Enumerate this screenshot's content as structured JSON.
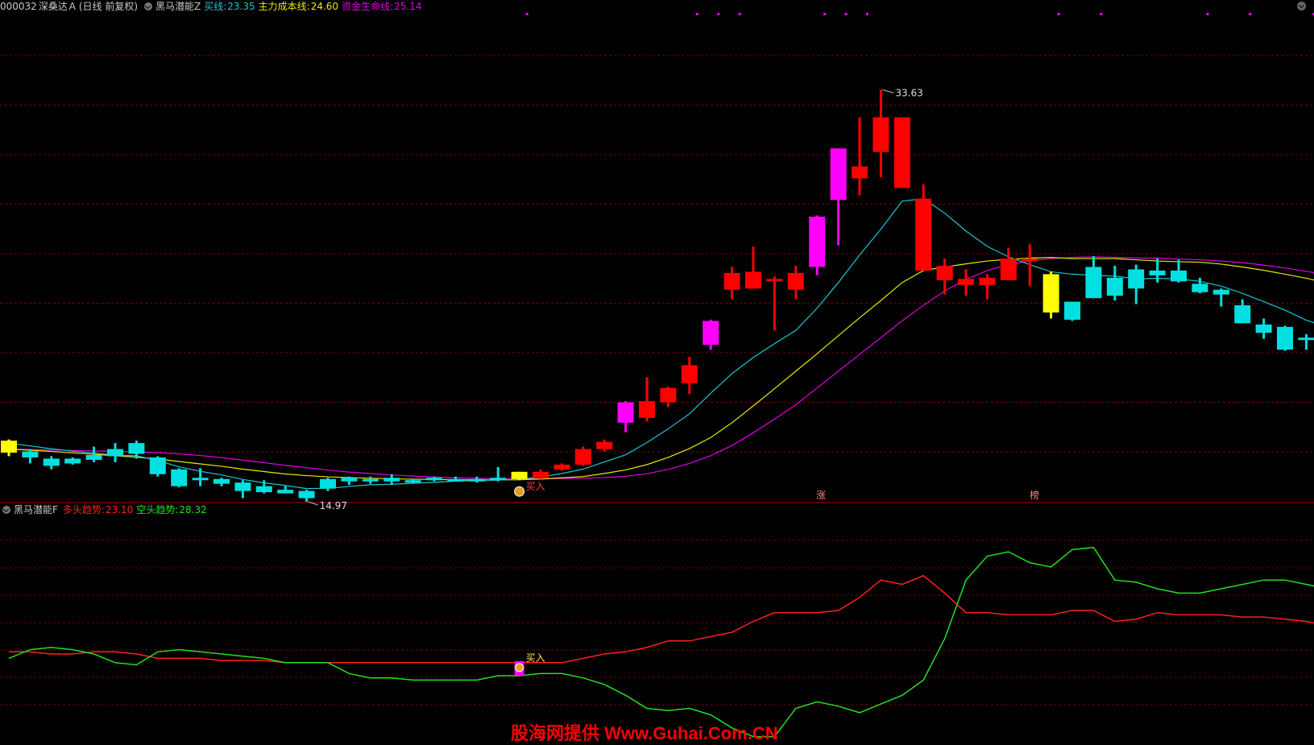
{
  "header": {
    "stock_code": "000032",
    "stock_name": "深桑达Ａ",
    "period": "(日线 前复权)",
    "indicator_name": "黑马潜能Z",
    "items": [
      {
        "label": "买线:",
        "value": "23.35",
        "color": "#19c8d2"
      },
      {
        "label": "主力成本线:",
        "value": "24.60",
        "color": "#e8e800"
      },
      {
        "label": "资金生命线:",
        "value": "25.14",
        "color": "#e000e0"
      }
    ]
  },
  "sub_header": {
    "indicator_name": "黑马潜能F",
    "items": [
      {
        "label": "多头趋势:",
        "value": "23.10",
        "color": "#ff2020"
      },
      {
        "label": "空头趋势:",
        "value": "28.32",
        "color": "#20e020"
      }
    ]
  },
  "colors": {
    "up": "#ff0000",
    "down": "#00e0e0",
    "special": "#ff00ff",
    "warn": "#ffff00",
    "grid": "#7a0000",
    "buy_line": "#19c8d2",
    "cost_line": "#e8e800",
    "life_line": "#e000e0"
  },
  "annotations": {
    "high_label": "33.63",
    "low_label": "14.97",
    "buy_label_main": "买入",
    "buy_label_sub": "买入",
    "event_zhang": "涨",
    "event_bang": "榜"
  },
  "watermark": "股海网提供 Www.Guhai.Com.CN",
  "chart_data": [
    {
      "type": "candlestick",
      "title": "黑马潜能Z",
      "y_range": [
        14.5,
        34.0
      ],
      "candles": [
        {
          "o": 16.95,
          "c": 16.45,
          "h": 17.0,
          "l": 16.3,
          "kind": "warn"
        },
        {
          "o": 16.5,
          "c": 16.25,
          "h": 16.6,
          "l": 16.0,
          "kind": "down"
        },
        {
          "o": 16.2,
          "c": 15.9,
          "h": 16.3,
          "l": 15.75,
          "kind": "down"
        },
        {
          "o": 16.2,
          "c": 16.0,
          "h": 16.25,
          "l": 15.95,
          "kind": "down"
        },
        {
          "o": 16.35,
          "c": 16.15,
          "h": 16.7,
          "l": 16.05,
          "kind": "down"
        },
        {
          "o": 16.6,
          "c": 16.3,
          "h": 16.85,
          "l": 16.05,
          "kind": "down"
        },
        {
          "o": 16.85,
          "c": 16.4,
          "h": 16.95,
          "l": 16.2,
          "kind": "down"
        },
        {
          "o": 16.25,
          "c": 15.55,
          "h": 16.3,
          "l": 15.45,
          "kind": "down"
        },
        {
          "o": 15.75,
          "c": 15.05,
          "h": 15.8,
          "l": 15.0,
          "kind": "down"
        },
        {
          "o": 15.4,
          "c": 15.3,
          "h": 15.8,
          "l": 15.05,
          "kind": "down"
        },
        {
          "o": 15.35,
          "c": 15.15,
          "h": 15.4,
          "l": 15.05,
          "kind": "down"
        },
        {
          "o": 15.2,
          "c": 14.85,
          "h": 15.3,
          "l": 14.55,
          "kind": "down"
        },
        {
          "o": 15.05,
          "c": 14.8,
          "h": 15.3,
          "l": 14.75,
          "kind": "down"
        },
        {
          "o": 14.9,
          "c": 14.75,
          "h": 15.05,
          "l": 14.75,
          "kind": "down"
        },
        {
          "o": 14.85,
          "c": 14.55,
          "h": 14.9,
          "l": 14.4,
          "kind": "down"
        },
        {
          "o": 15.35,
          "c": 14.95,
          "h": 15.4,
          "l": 14.85,
          "kind": "down"
        },
        {
          "o": 15.4,
          "c": 15.25,
          "h": 15.45,
          "l": 15.1,
          "kind": "down"
        },
        {
          "o": 15.35,
          "c": 15.3,
          "h": 15.45,
          "l": 15.15,
          "kind": "down"
        },
        {
          "o": 15.4,
          "c": 15.25,
          "h": 15.55,
          "l": 15.1,
          "kind": "down"
        },
        {
          "o": 15.3,
          "c": 15.2,
          "h": 15.35,
          "l": 15.15,
          "kind": "down"
        },
        {
          "o": 15.4,
          "c": 15.3,
          "h": 15.45,
          "l": 15.25,
          "kind": "down"
        },
        {
          "o": 15.35,
          "c": 15.3,
          "h": 15.45,
          "l": 15.25,
          "kind": "down"
        },
        {
          "o": 15.35,
          "c": 15.25,
          "h": 15.45,
          "l": 15.2,
          "kind": "down"
        },
        {
          "o": 15.4,
          "c": 15.35,
          "h": 15.85,
          "l": 15.25,
          "kind": "down"
        },
        {
          "o": 15.65,
          "c": 15.35,
          "h": 15.65,
          "l": 15.3,
          "kind": "warn"
        },
        {
          "o": 15.4,
          "c": 15.65,
          "h": 15.75,
          "l": 15.35,
          "kind": "up"
        },
        {
          "o": 15.75,
          "c": 15.95,
          "h": 16.0,
          "l": 15.7,
          "kind": "up"
        },
        {
          "o": 15.95,
          "c": 16.6,
          "h": 16.7,
          "l": 15.9,
          "kind": "up"
        },
        {
          "o": 16.6,
          "c": 16.9,
          "h": 17.0,
          "l": 16.5,
          "kind": "up"
        },
        {
          "o": 17.7,
          "c": 18.55,
          "h": 18.6,
          "l": 17.3,
          "kind": "special"
        },
        {
          "o": 17.9,
          "c": 18.6,
          "h": 19.6,
          "l": 17.75,
          "kind": "up"
        },
        {
          "o": 18.55,
          "c": 19.15,
          "h": 19.2,
          "l": 18.35,
          "kind": "up"
        },
        {
          "o": 19.35,
          "c": 20.1,
          "h": 20.45,
          "l": 18.9,
          "kind": "up"
        },
        {
          "o": 20.95,
          "c": 21.95,
          "h": 22.0,
          "l": 20.75,
          "kind": "special"
        },
        {
          "o": 23.25,
          "c": 23.95,
          "h": 24.2,
          "l": 22.85,
          "kind": "up"
        },
        {
          "o": 23.3,
          "c": 24.0,
          "h": 25.05,
          "l": 23.3,
          "kind": "up"
        },
        {
          "o": 23.6,
          "c": 23.7,
          "h": 23.8,
          "l": 21.55,
          "kind": "up"
        },
        {
          "o": 23.25,
          "c": 23.95,
          "h": 24.25,
          "l": 22.85,
          "kind": "up"
        },
        {
          "o": 24.2,
          "c": 26.3,
          "h": 26.35,
          "l": 23.85,
          "kind": "special"
        },
        {
          "o": 27.0,
          "c": 29.15,
          "h": 29.15,
          "l": 25.1,
          "kind": "special"
        },
        {
          "o": 27.9,
          "c": 28.4,
          "h": 30.45,
          "l": 27.2,
          "kind": "up"
        },
        {
          "o": 29.0,
          "c": 30.45,
          "h": 31.6,
          "l": 27.95,
          "kind": "up"
        },
        {
          "o": 27.5,
          "c": 30.45,
          "h": 30.45,
          "l": 27.5,
          "kind": "up"
        },
        {
          "o": 24.05,
          "c": 27.05,
          "h": 27.65,
          "l": 24.05,
          "kind": "up"
        },
        {
          "o": 23.65,
          "c": 24.25,
          "h": 24.55,
          "l": 23.05,
          "kind": "up"
        },
        {
          "o": 23.45,
          "c": 23.7,
          "h": 24.1,
          "l": 23.0,
          "kind": "up"
        },
        {
          "o": 23.45,
          "c": 23.75,
          "h": 23.9,
          "l": 22.85,
          "kind": "up"
        },
        {
          "o": 23.65,
          "c": 24.55,
          "h": 25.0,
          "l": 23.65,
          "kind": "up"
        },
        {
          "o": 24.45,
          "c": 24.55,
          "h": 25.15,
          "l": 23.4,
          "kind": "up"
        },
        {
          "o": 23.9,
          "c": 22.3,
          "h": 24.0,
          "l": 22.05,
          "kind": "warn"
        },
        {
          "o": 22.75,
          "c": 22.0,
          "h": 22.75,
          "l": 21.95,
          "kind": "down"
        },
        {
          "o": 24.2,
          "c": 22.9,
          "h": 24.65,
          "l": 22.9,
          "kind": "down"
        },
        {
          "o": 23.75,
          "c": 23.0,
          "h": 24.25,
          "l": 22.8,
          "kind": "down"
        },
        {
          "o": 24.1,
          "c": 23.3,
          "h": 24.3,
          "l": 22.65,
          "kind": "down"
        },
        {
          "o": 24.05,
          "c": 23.85,
          "h": 24.55,
          "l": 23.55,
          "kind": "down"
        },
        {
          "o": 24.05,
          "c": 23.6,
          "h": 24.5,
          "l": 23.55,
          "kind": "down"
        },
        {
          "o": 23.5,
          "c": 23.15,
          "h": 23.75,
          "l": 23.1,
          "kind": "down"
        },
        {
          "o": 23.25,
          "c": 23.05,
          "h": 23.3,
          "l": 22.55,
          "kind": "down"
        },
        {
          "o": 22.6,
          "c": 21.85,
          "h": 22.85,
          "l": 21.85,
          "kind": "down"
        },
        {
          "o": 21.8,
          "c": 21.45,
          "h": 22.05,
          "l": 21.2,
          "kind": "down"
        },
        {
          "o": 21.7,
          "c": 20.75,
          "h": 21.75,
          "l": 20.7,
          "kind": "down"
        },
        {
          "o": 21.25,
          "c": 21.2,
          "h": 21.4,
          "l": 20.75,
          "kind": "down"
        },
        {
          "o": 21.1,
          "c": 20.7,
          "h": 21.15,
          "l": 20.7,
          "kind": "down"
        }
      ],
      "buy_line": [
        16.85,
        16.73,
        16.61,
        16.51,
        16.43,
        16.35,
        16.32,
        16.12,
        15.86,
        15.67,
        15.52,
        15.33,
        15.19,
        15.08,
        14.95,
        14.96,
        15.04,
        15.11,
        15.13,
        15.17,
        15.21,
        15.26,
        15.29,
        15.3,
        15.34,
        15.43,
        15.58,
        15.76,
        16.06,
        16.36,
        16.87,
        17.44,
        18.07,
        18.93,
        19.75,
        20.42,
        21.0,
        21.55,
        22.48,
        23.55,
        24.7,
        25.78,
        26.95,
        27.05,
        26.45,
        25.7,
        25.06,
        24.62,
        24.3,
        24.0,
        23.9,
        23.85,
        23.82,
        23.7,
        23.73,
        23.7,
        23.6,
        23.4,
        23.1,
        22.75,
        22.4,
        21.98,
        21.7,
        21.55,
        21.52,
        21.35
      ],
      "cost_line": [
        16.6,
        16.55,
        16.5,
        16.44,
        16.38,
        16.32,
        16.26,
        16.18,
        16.08,
        15.98,
        15.88,
        15.76,
        15.66,
        15.56,
        15.49,
        15.44,
        15.41,
        15.38,
        15.36,
        15.34,
        15.33,
        15.32,
        15.31,
        15.31,
        15.32,
        15.35,
        15.4,
        15.45,
        15.58,
        15.73,
        15.95,
        16.25,
        16.62,
        17.08,
        17.7,
        18.4,
        19.12,
        19.85,
        20.58,
        21.33,
        22.08,
        22.8,
        23.55,
        24.05,
        24.2,
        24.33,
        24.45,
        24.52,
        24.57,
        24.6,
        24.55,
        24.55,
        24.55,
        24.5,
        24.45,
        24.42,
        24.4,
        24.32,
        24.2,
        24.06,
        23.9,
        23.73,
        23.53,
        23.35,
        23.2,
        23.05
      ],
      "life_line": [
        16.6,
        16.58,
        16.56,
        16.54,
        16.52,
        16.5,
        16.48,
        16.45,
        16.4,
        16.33,
        16.24,
        16.14,
        16.03,
        15.92,
        15.82,
        15.72,
        15.64,
        15.58,
        15.52,
        15.47,
        15.43,
        15.4,
        15.38,
        15.36,
        15.35,
        15.36,
        15.37,
        15.38,
        15.41,
        15.46,
        15.57,
        15.75,
        16.0,
        16.32,
        16.75,
        17.28,
        17.85,
        18.45,
        19.15,
        19.85,
        20.55,
        21.25,
        21.95,
        22.6,
        23.2,
        23.68,
        24.05,
        24.3,
        24.45,
        24.55,
        24.6,
        24.62,
        24.6,
        24.58,
        24.57,
        24.53,
        24.5,
        24.45,
        24.38,
        24.28,
        24.16,
        24.02,
        23.86,
        23.7,
        23.55,
        23.38
      ]
    },
    {
      "type": "line",
      "title": "黑马潜能F",
      "y_range": [
        0,
        100
      ],
      "series": [
        {
          "name": "多头趋势",
          "color": "#ff2020",
          "values": [
            41,
            41,
            40,
            40,
            41,
            41,
            40,
            38,
            38,
            38,
            37,
            37,
            37,
            36,
            36,
            36,
            36,
            36,
            36,
            36,
            36,
            36,
            36,
            36,
            36,
            36,
            36,
            38,
            40,
            41,
            43,
            46,
            46,
            48,
            50,
            55,
            59,
            59,
            59,
            60,
            66,
            74,
            72,
            76,
            68,
            59,
            59,
            58,
            58,
            58,
            60,
            60,
            55,
            56,
            59,
            58,
            58,
            58,
            57,
            57,
            56,
            55,
            53,
            53,
            52,
            51,
            51
          ]
        },
        {
          "name": "空头趋势",
          "color": "#20e020",
          "values": [
            38,
            42,
            43,
            42,
            40,
            36,
            35,
            41,
            42,
            41,
            40,
            39,
            38,
            36,
            36,
            36,
            31,
            29,
            29,
            28,
            28,
            28,
            28,
            30,
            30,
            31,
            31,
            29,
            26,
            21,
            15,
            14,
            15,
            12,
            6,
            2,
            2,
            15,
            18,
            16,
            13,
            17,
            21,
            28,
            47,
            74,
            85,
            87,
            82,
            80,
            88,
            89,
            74,
            73,
            70,
            68,
            68,
            70,
            72,
            74,
            74,
            72,
            70,
            67,
            67
          ]
        }
      ],
      "buy_marker_index": 24
    }
  ],
  "top_dots_index": [
    24,
    32,
    33,
    34,
    38,
    39,
    40,
    49,
    51,
    56,
    58,
    61
  ]
}
